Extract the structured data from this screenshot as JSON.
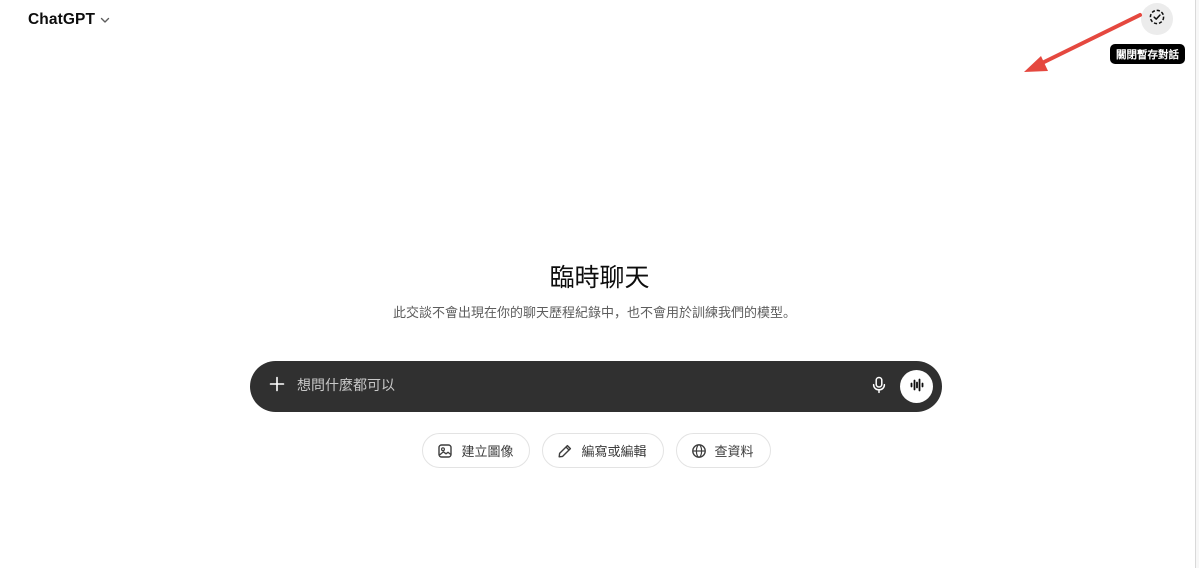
{
  "header": {
    "model_name": "ChatGPT",
    "model_chevron_icon": "chevron-down-icon",
    "temporary_chat_icon": "dashed-circle-check-icon",
    "tooltip": "關閉暫存對話"
  },
  "annotation": {
    "arrow_color": "#e5483f"
  },
  "hero": {
    "title": "臨時聊天",
    "subtitle": "此交談不會出現在你的聊天歷程紀錄中，也不會用於訓練我們的模型。"
  },
  "composer": {
    "placeholder": "想問什麼都可以",
    "value": "",
    "plus_icon": "plus-icon",
    "mic_icon": "microphone-icon",
    "voice_icon": "voice-waveform-icon",
    "background": "#303030"
  },
  "suggestions": [
    {
      "label": "建立圖像",
      "icon": "image-icon"
    },
    {
      "label": "編寫或編輯",
      "icon": "pencil-icon"
    },
    {
      "label": "查資料",
      "icon": "globe-icon"
    }
  ]
}
